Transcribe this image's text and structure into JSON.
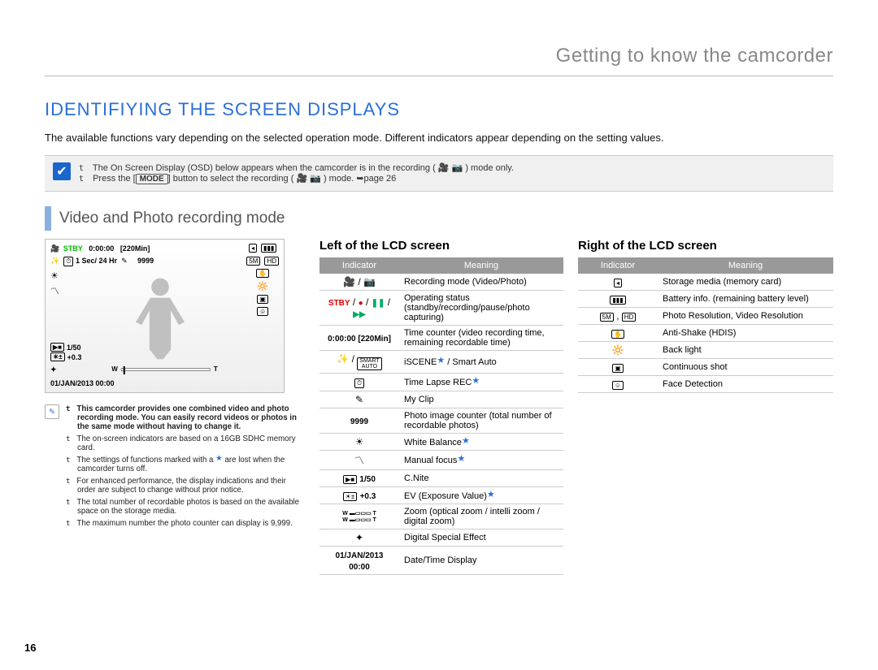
{
  "page_number": "16",
  "chapter": "Getting to know the camcorder",
  "section_title": "IDENTIFIYING THE SCREEN DISPLAYS",
  "intro": "The available functions vary depending on the selected operation mode. Different indicators appear depending on the setting values.",
  "top_note": {
    "line1_pre": "The On Screen Display (OSD) below appears when the camcorder is in the recording (",
    "line1_post": ") mode only.",
    "line2_pre": "Press the [",
    "line2_mode": "MODE",
    "line2_mid": "] button to select the recording (",
    "line2_post": ") mode. ",
    "line2_ref": "page 26"
  },
  "subsection": "Video and Photo recording mode",
  "lcd": {
    "stby": "STBY",
    "time": "0:00:00",
    "remain": "[220Min]",
    "interval": "1 Sec/ 24 Hr",
    "photo_count": "9999",
    "shutter": "1/50",
    "ev": "+0.3",
    "datetime": "01/JAN/2013 00:00",
    "zoom_w": "W",
    "zoom_t": "T"
  },
  "small_notes": [
    "This camcorder provides one combined video and photo recording mode. You can easily record videos or photos in the same mode without having to change it.",
    "The on-screen indicators are based on a 16GB SDHC memory card.",
    "The settings of functions marked with a ★ are lost when the camcorder turns off.",
    "For enhanced performance, the display indications and their order are subject to change without prior notice.",
    "The total number of recordable photos is based on the available space on the storage media.",
    "The maximum number the photo counter can display is 9,999."
  ],
  "left_heading": "Left of the LCD screen",
  "right_heading": "Right of the LCD screen",
  "table_headers": {
    "indicator": "Indicator",
    "meaning": "Meaning"
  },
  "left_table": [
    {
      "ind": "mode",
      "meaning": "Recording mode (Video/Photo)"
    },
    {
      "ind": "status",
      "meaning": "Operating status (standby/recording/pause/photo capturing)"
    },
    {
      "ind": "timecounter",
      "txt": "0:00:00 [220Min]",
      "meaning": "Time counter (video recording time, remaining recordable time)"
    },
    {
      "ind": "iscene",
      "meaning": "iSCENE★ / Smart Auto"
    },
    {
      "ind": "timelapse",
      "meaning": "Time Lapse REC★"
    },
    {
      "ind": "myclip",
      "meaning": "My Clip"
    },
    {
      "ind": "photocount",
      "txt": "9999",
      "meaning": "Photo image counter (total number of recordable photos)"
    },
    {
      "ind": "wb",
      "meaning": "White Balance★"
    },
    {
      "ind": "mf",
      "meaning": "Manual focus★"
    },
    {
      "ind": "cnite",
      "txt": "1/50",
      "meaning": "C.Nite"
    },
    {
      "ind": "ev",
      "txt": "+0.3",
      "meaning": "EV (Exposure Value)★"
    },
    {
      "ind": "zoom",
      "meaning": "Zoom (optical zoom / intelli zoom / digital zoom)"
    },
    {
      "ind": "dse",
      "meaning": "Digital Special Effect"
    },
    {
      "ind": "datetime",
      "txt": "01/JAN/2013 00:00",
      "meaning": "Date/Time Display"
    }
  ],
  "right_table": [
    {
      "ind": "storage",
      "meaning": "Storage media (memory card)"
    },
    {
      "ind": "battery",
      "meaning": "Battery info. (remaining battery level)"
    },
    {
      "ind": "resolution",
      "meaning": "Photo Resolution, Video Resolution"
    },
    {
      "ind": "antishake",
      "meaning": "Anti-Shake (HDIS)"
    },
    {
      "ind": "backlight",
      "meaning": "Back light"
    },
    {
      "ind": "continuous",
      "meaning": "Continuous shot"
    },
    {
      "ind": "face",
      "meaning": "Face Detection"
    }
  ]
}
